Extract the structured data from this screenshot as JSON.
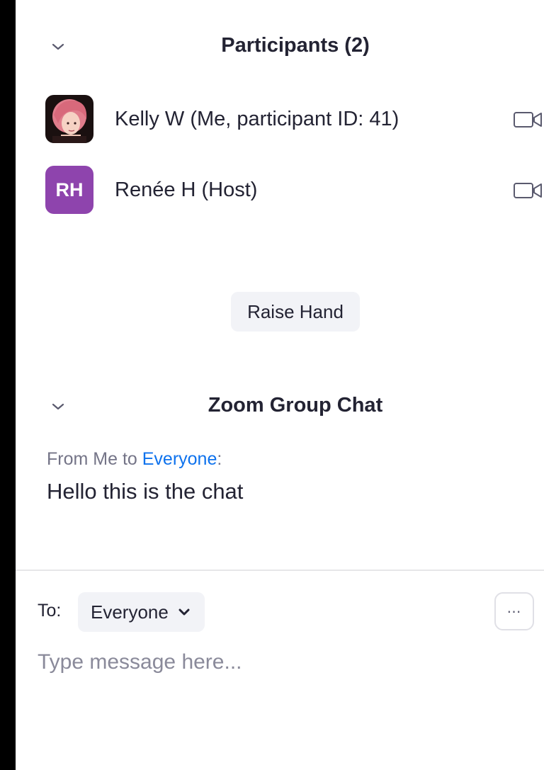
{
  "participants_panel": {
    "title": "Participants (2)",
    "collapse_icon": "chevron-down-icon",
    "participants": [
      {
        "name": "Kelly W (Me, participant ID: 41)",
        "avatar_type": "image",
        "video_icon": "video-camera-icon"
      },
      {
        "name": "Renée H (Host)",
        "avatar_type": "initials",
        "initials": "RH",
        "avatar_color": "#8e44ad",
        "video_icon": "video-camera-icon"
      }
    ],
    "raise_hand_label": "Raise Hand"
  },
  "chat_panel": {
    "title": "Zoom Group Chat",
    "collapse_icon": "chevron-down-icon",
    "messages": [
      {
        "from_prefix": "From Me to ",
        "recipient": "Everyone",
        "suffix": ":",
        "text": "Hello this is the chat"
      }
    ],
    "compose": {
      "to_label": "To:",
      "recipient": "Everyone",
      "placeholder": "Type message here...",
      "more_icon": "ellipsis-icon"
    }
  },
  "colors": {
    "accent": "#0e72ed",
    "text": "#232333",
    "muted_text": "#747487",
    "button_bg": "#f2f3f7"
  }
}
